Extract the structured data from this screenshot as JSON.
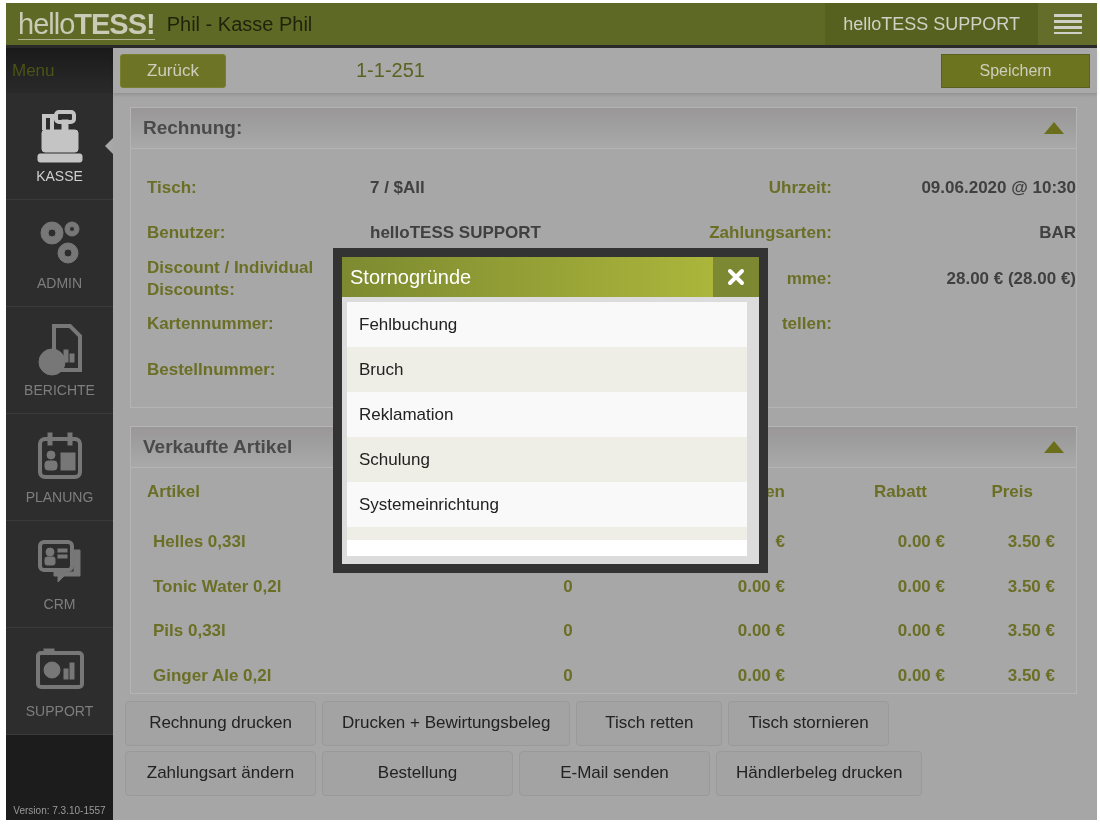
{
  "header": {
    "logo_light": "hello",
    "logo_bold": "TESS!",
    "title": "Phil - Kasse Phil",
    "user": "helloTESS SUPPORT"
  },
  "sidebar": {
    "title": "Menu",
    "items": [
      {
        "label": "KASSE",
        "kind": "register",
        "selected": true
      },
      {
        "label": "ADMIN",
        "kind": "gears",
        "selected": false
      },
      {
        "label": "BERICHTE",
        "kind": "report",
        "selected": false
      },
      {
        "label": "PLANUNG",
        "kind": "calendar",
        "selected": false
      },
      {
        "label": "CRM",
        "kind": "contacts",
        "selected": false
      },
      {
        "label": "SUPPORT",
        "kind": "dashboard",
        "selected": false
      }
    ],
    "version": "Version: 7.3.10-1557"
  },
  "toolbar": {
    "back": "Zurück",
    "number": "1-1-251",
    "save": "Speichern"
  },
  "invoice": {
    "title": "Rechnung:",
    "expanded": true,
    "rows": [
      {
        "label": "Tisch:",
        "value": "7 / $All",
        "label_2": "Uhrzeit:",
        "value_2": "09.06.2020 @ 10:30"
      },
      {
        "label": "Benutzer:",
        "value": "helloTESS SUPPORT",
        "label_2": "Zahlungsarten:",
        "value_2": "BAR"
      },
      {
        "label": "Discount / Individual Discounts:",
        "label_2": "mme:",
        "value_2": "28.00 € (28.00 €)"
      },
      {
        "label": "Kartennummer:",
        "label_2": "tellen:"
      },
      {
        "label": "Bestellnummer:"
      }
    ]
  },
  "items": {
    "title": "Verkaufte Artikel",
    "expanded": true,
    "columns": {
      "artikel": "Artikel",
      "column_3": "en",
      "rabatt": "Rabatt",
      "preis": "Preis"
    },
    "rows": [
      {
        "artikel": "Helles 0,33l",
        "column_3": "€",
        "rabatt": "0.00 €",
        "preis": "3.50 €"
      },
      {
        "artikel": "Tonic Water 0,2l",
        "column_2": "0",
        "column_3": "0.00 €",
        "rabatt": "0.00 €",
        "preis": "3.50 €"
      },
      {
        "artikel": "Pils 0,33l",
        "column_2": "0",
        "column_3": "0.00 €",
        "rabatt": "0.00 €",
        "preis": "3.50 €"
      },
      {
        "artikel": "Ginger Ale 0,2l",
        "column_2": "0",
        "column_3": "0.00 €",
        "rabatt": "0.00 €",
        "preis": "3.50 €"
      }
    ]
  },
  "actions": [
    [
      "Rechnung drucken",
      "Drucken + Bewirtungsbeleg",
      "Tisch retten",
      "Tisch stornieren"
    ],
    [
      "Zahlungsart ändern",
      "Bestellung",
      "E-Mail senden",
      "Händlerbeleg drucken"
    ]
  ],
  "dialog": {
    "title": "Stornogründe",
    "reasons": [
      {
        "label": "Fehlbuchung"
      },
      {
        "label": "Bruch"
      },
      {
        "label": "Reklamation"
      },
      {
        "label": "Schulung"
      },
      {
        "label": "Systemeinrichtung"
      }
    ]
  }
}
